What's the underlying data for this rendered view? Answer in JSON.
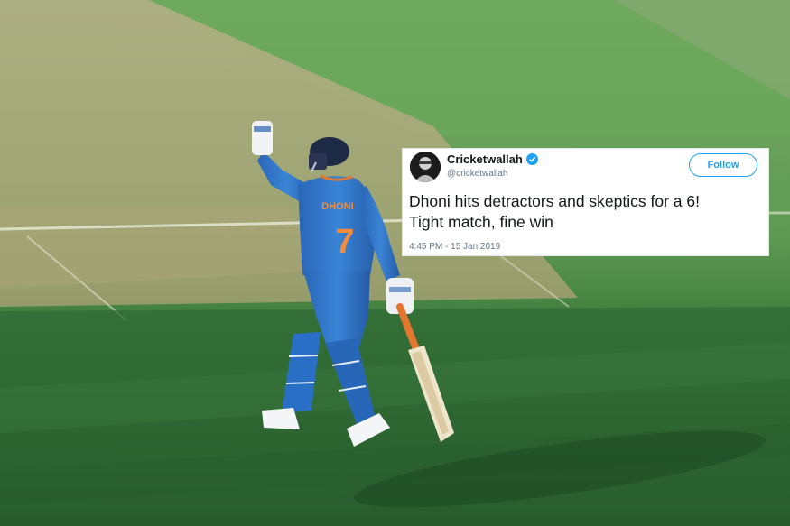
{
  "tweet": {
    "display_name": "Cricketwallah",
    "handle": "@cricketwallah",
    "follow_label": "Follow",
    "text_line1": "Dhoni hits detractors and skeptics for a 6!",
    "text_line2": "Tight match, fine win",
    "timestamp": "4:45 PM - 15 Jan 2019",
    "verified_icon": "verified-badge-icon",
    "accent_color": "#1da1f2"
  },
  "photo": {
    "jersey_name": "DHONI",
    "jersey_number": "7",
    "pitch_color": "#3f7d3e",
    "kit_color": "#2d72c4"
  }
}
